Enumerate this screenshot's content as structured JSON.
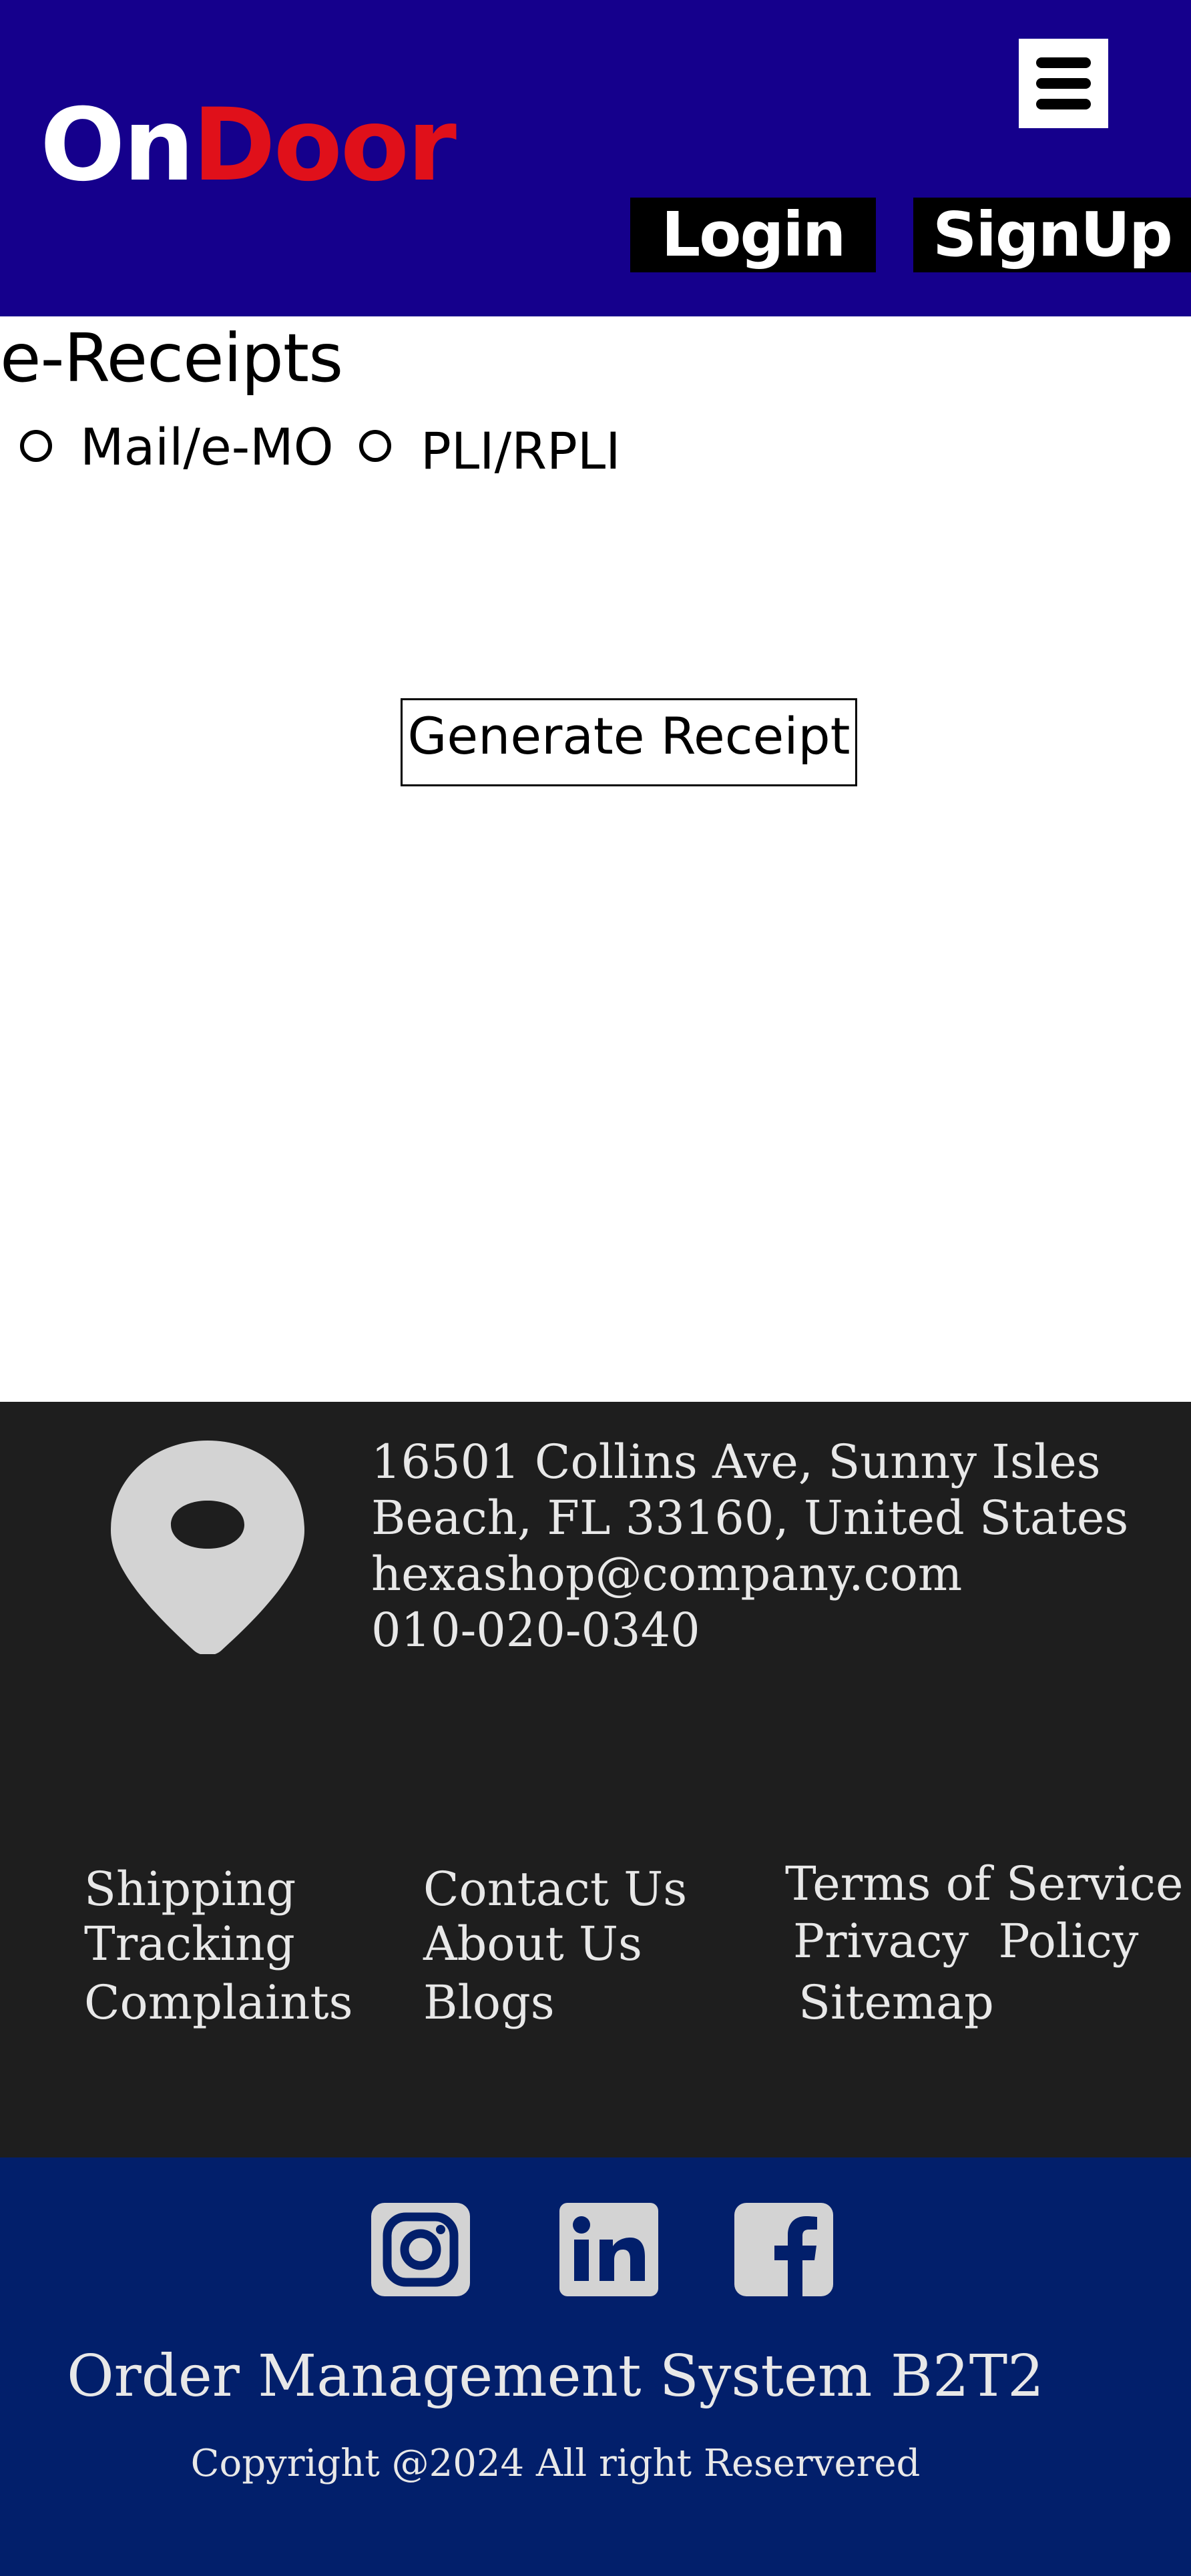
{
  "header": {
    "logo_part1": "On",
    "logo_part2": "Door",
    "menu_icon": "hamburger-menu-icon",
    "login_label": "Login",
    "signup_label": "SignUp",
    "colors": {
      "background": "#15008c",
      "logo_accent": "#e0101a"
    }
  },
  "main": {
    "title": "e-Receipts",
    "options": [
      {
        "label": "Mail/e-MO",
        "selected": false
      },
      {
        "label": "PLI/RPLI",
        "selected": false
      }
    ],
    "generate_label": "Generate Receipt"
  },
  "footer": {
    "location_icon": "map-pin-icon",
    "address_line1": "16501 Collins Ave, Sunny Isles",
    "address_line2": "Beach, FL 33160, United States",
    "email": "hexashop@company.com",
    "phone": "010-020-0340",
    "col1": [
      "Shipping",
      "Tracking",
      "Complaints"
    ],
    "col2": [
      "Contact Us",
      "About Us",
      "Blogs"
    ],
    "col3": [
      "Terms of Service",
      "Privacy  Policy",
      "Sitemap"
    ],
    "social_icons": [
      "instagram-icon",
      "linkedin-icon",
      "facebook-icon"
    ],
    "system_name": "Order Management System B2T2",
    "copyright": "Copyright @2024 All right Reservered",
    "colors": {
      "footer_bg": "#1e1e1e",
      "bottom_bg": "#021f6b"
    }
  }
}
